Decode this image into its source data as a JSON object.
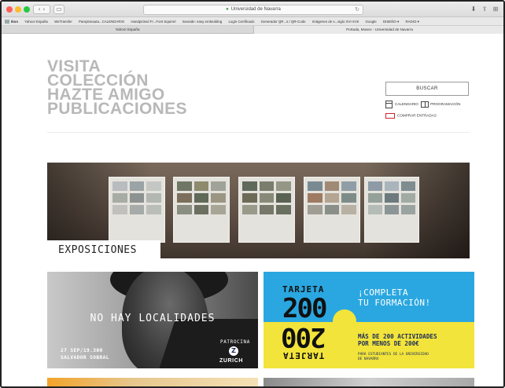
{
  "browser": {
    "url": "Universidad de Navarra",
    "bookmarks": [
      "Ikon",
      "Yahoo! España",
      "WeTransfer",
      "Pamplonauta...CALENDARIO",
      "Handpicked Fr...Font Squirrel",
      "Seaside: easy embedding",
      "Login Certificado",
      "Generador QR...s / QR-Code",
      "Imágenes de s...siglo XVI-XVII",
      "Google",
      "DISEÑO ▾",
      "RADIO ▾"
    ],
    "tabs": [
      "Yahoo! España",
      "Portada, Museo - Universidad de Navarra"
    ]
  },
  "nav": {
    "items": [
      "VISITA",
      "COLECCIÓN",
      "HAZTE AMIGO",
      "PUBLICACIONES"
    ]
  },
  "utility": {
    "search_label": "BUSCAR",
    "calendar_label": "CALENDARIO",
    "program_label": "PROGRAMACIÓN",
    "tickets_label": "COMPRAR ENTRADAS"
  },
  "hero": {
    "section_label": "EXPOSICIONES"
  },
  "card_left": {
    "title": "NO HAY LOCALIDADES",
    "date": "27 SEP/19.30H",
    "name": "SALVADOR SOBRAL",
    "sponsor_label": "PATROCINA",
    "sponsor_logo_letter": "Z",
    "sponsor_name": "ZURICH"
  },
  "card_right": {
    "tarjeta": "TARJETA",
    "number": "200",
    "headline_1": "¡COMPLETA",
    "headline_2": "TU FORMACIÓN!",
    "offer_1": "MÁS DE 200 ACTIVIDADES",
    "offer_2": "POR MENOS DE 200€",
    "fine_1": "PARA ESTUDIANTES DE LA UNIVERSIDAD",
    "fine_2": "DE NAVARRA"
  },
  "colors": {
    "accent_red": "#d0222a",
    "card_blue": "#2aa7e0",
    "card_yellow": "#f2e43a",
    "nav_grey": "#b8b8b8"
  }
}
